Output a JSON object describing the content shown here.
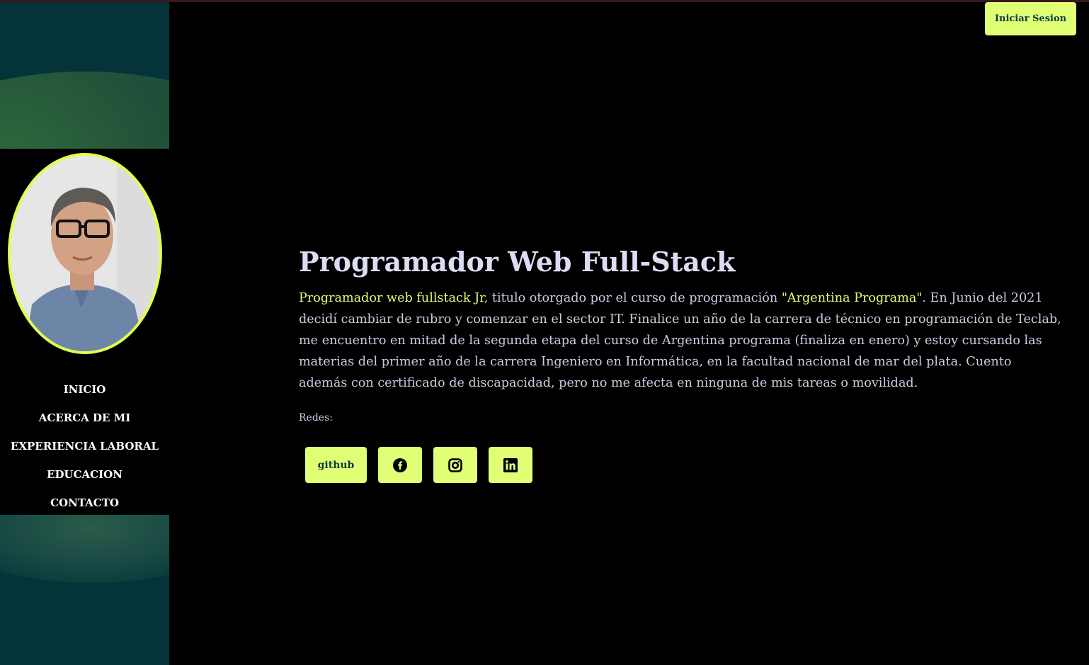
{
  "header": {
    "login_label": "Iniciar Sesion"
  },
  "sidebar": {
    "nav": [
      {
        "label": "INICIO"
      },
      {
        "label": "ACERCA DE MI"
      },
      {
        "label": "EXPERIENCIA LABORAL"
      },
      {
        "label": "EDUCACION"
      },
      {
        "label": "CONTACTO"
      }
    ]
  },
  "main": {
    "title": "Programador Web Full-Stack",
    "intro_highlight": "Programador web fullstack Jr",
    "intro_text_1": ", titulo otorgado por el curso de programación ",
    "intro_highlight_2": "\"Argentina Programa\"",
    "intro_text_2": ". En Junio del 2021 decidí cambiar de rubro y comenzar en el sector IT. Finalice un año de la carrera de técnico en programación de Teclab, me encuentro en mitad de la segunda etapa del curso de Argentina programa (finaliza en enero) y estoy cursando las materias del primer año de la carrera Ingeniero en Informática, en la facultad nacional de mar del plata. Cuento además con certificado de discapacidad, pero no me afecta en ninguna de mis tareas o movilidad.",
    "redes_label": "Redes:",
    "social": {
      "github_label": "github",
      "facebook_icon": "facebook-icon",
      "instagram_icon": "instagram-icon",
      "linkedin_icon": "linkedin-icon"
    }
  },
  "colors": {
    "accent": "#e0ff74",
    "background": "#000000",
    "sidebar_bg": "#04343a",
    "button_text": "#0b3d3a"
  }
}
